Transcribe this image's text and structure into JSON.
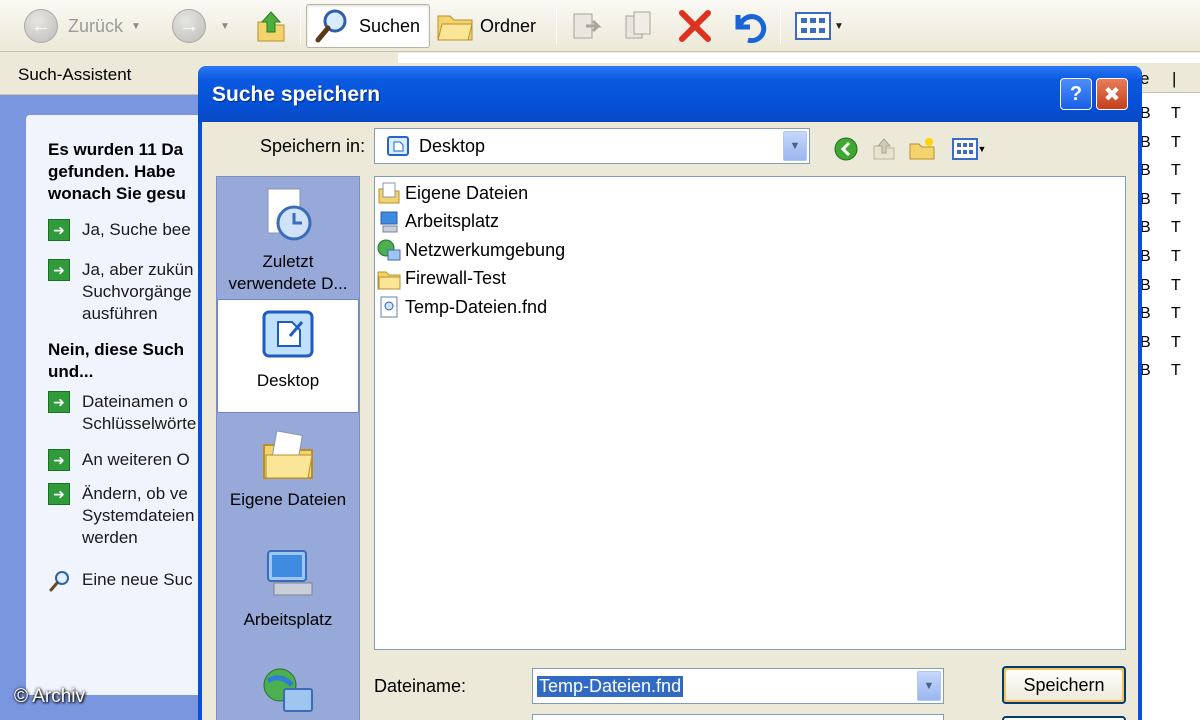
{
  "toolbar": {
    "back_label": "Zurück",
    "search_label": "Suchen",
    "folders_label": "Ordner"
  },
  "assistant": {
    "header": "Such-Assistent",
    "intro_lines": [
      "Es wurden 11 Da",
      "gefunden. Habe",
      "wonach Sie gesu"
    ],
    "yes_links": [
      [
        "Ja, Suche bee"
      ],
      [
        "Ja, aber zukün",
        "Suchvorgänge",
        "ausführen"
      ]
    ],
    "no_heading": [
      "Nein, diese Such",
      "und..."
    ],
    "no_links": [
      [
        "Dateinamen o",
        "Schlüsselwörte"
      ],
      [
        "An weiteren O"
      ],
      [
        "Ändern, ob ve",
        "Systemdateien",
        "werden"
      ]
    ],
    "new_search": "Eine neue Suc"
  },
  "list_behind": {
    "header_fragment": "e",
    "col1": "B",
    "col2": "T",
    "row_count": 10
  },
  "dialog": {
    "title": "Suche speichern",
    "save_in_label": "Speichern in:",
    "save_in_value": "Desktop",
    "places": [
      {
        "label_lines": [
          "Zuletzt",
          "verwendete D..."
        ],
        "icon": "recent-documents-icon"
      },
      {
        "label_lines": [
          "Desktop"
        ],
        "icon": "desktop-icon",
        "selected": true
      },
      {
        "label_lines": [
          "Eigene Dateien"
        ],
        "icon": "my-documents-icon"
      },
      {
        "label_lines": [
          "Arbeitsplatz"
        ],
        "icon": "my-computer-icon"
      },
      {
        "label_lines": [
          ""
        ],
        "icon": "network-icon"
      }
    ],
    "files": [
      {
        "name": "Eigene Dateien",
        "icon": "my-documents-icon"
      },
      {
        "name": "Arbeitsplatz",
        "icon": "my-computer-icon"
      },
      {
        "name": "Netzwerkumgebung",
        "icon": "network-icon"
      },
      {
        "name": "Firewall-Test",
        "icon": "folder-icon"
      },
      {
        "name": "Temp-Dateien.fnd",
        "icon": "search-file-icon"
      }
    ],
    "filename_label": "Dateiname:",
    "filename_value": "Temp-Dateien.fnd",
    "save_button": "Speichern"
  },
  "watermark": "© Archiv",
  "colors": {
    "title_bar": "#0a59e0",
    "assistant_bg": "#7a96df",
    "places_bg": "#97a9d9",
    "selection": "#316ac5"
  }
}
